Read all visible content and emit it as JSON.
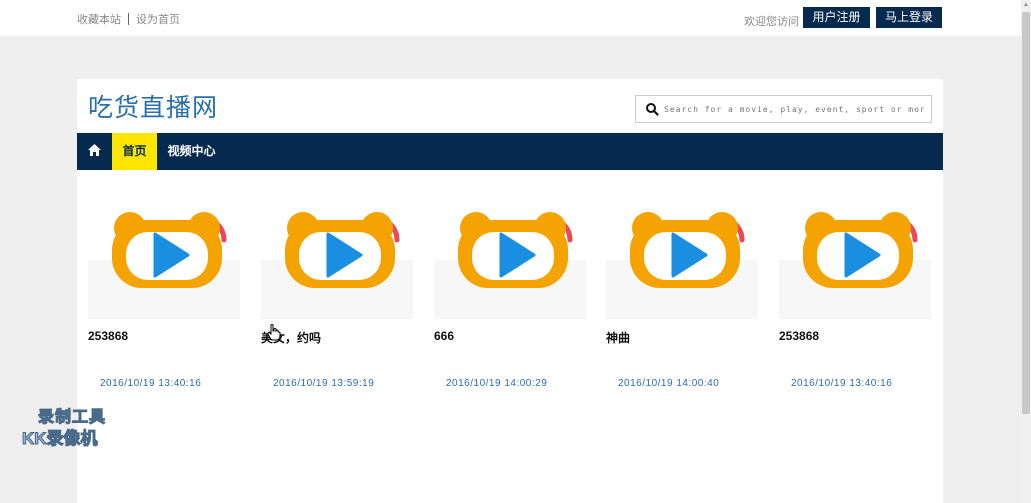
{
  "topbar": {
    "bookmark": "收藏本站",
    "set_home": "设为首页",
    "welcome": "欢迎您访问",
    "register": "用户注册",
    "login": "马上登录"
  },
  "header": {
    "logo": "吃货直播网",
    "search_placeholder": "Search for a movie, play, event, sport or more"
  },
  "nav": {
    "home_icon": "home-icon",
    "items": [
      {
        "label": "首页",
        "active": true
      },
      {
        "label": "视频中心",
        "active": false
      }
    ]
  },
  "videos": [
    {
      "title": "253868",
      "date": "2016/10/19 13:40:16"
    },
    {
      "title": "美女，约吗",
      "date": "2016/10/19 13:59:19"
    },
    {
      "title": "666",
      "date": "2016/10/19 14:00:29"
    },
    {
      "title": "神曲",
      "date": "2016/10/19 14:00:40"
    },
    {
      "title": "253868",
      "date": "2016/10/19 13:40:16"
    }
  ],
  "watermark": {
    "line1": "录制工具",
    "line2": "KK录像机"
  },
  "colors": {
    "nav_bg": "#062a4d",
    "nav_active": "#ffe600",
    "logo": "#2a6fa8",
    "icon_orange": "#f5a300",
    "icon_blue": "#1a8ee0",
    "icon_red": "#e8485a"
  }
}
